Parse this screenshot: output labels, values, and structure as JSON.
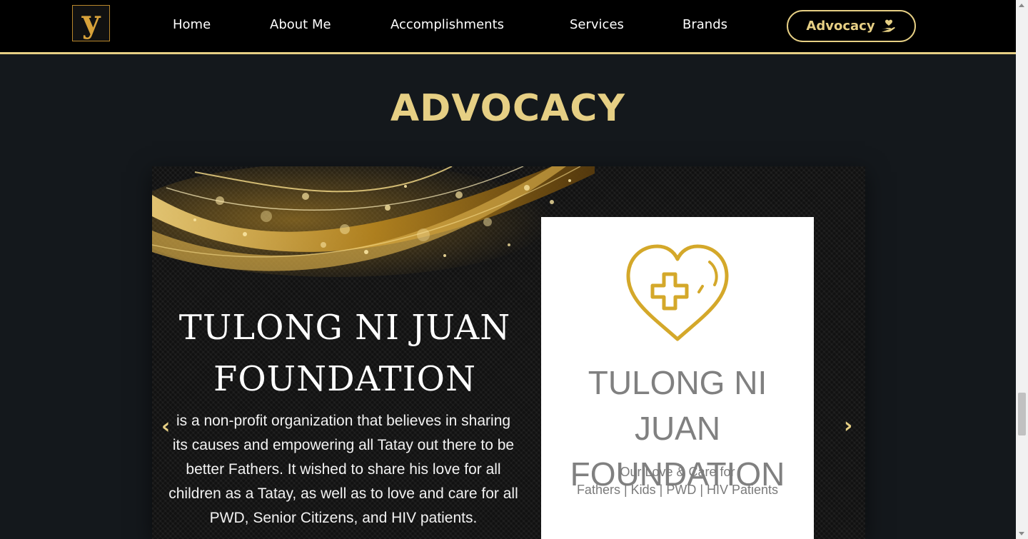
{
  "nav": {
    "logo_letter": "y",
    "links": [
      "Home",
      "About Me",
      "Accomplishments",
      "Services",
      "Brands"
    ],
    "cta": {
      "label": "Advocacy",
      "icon": "hand-holding-heart-icon"
    }
  },
  "section": {
    "title": "ADVOCACY"
  },
  "slide": {
    "title_line1": "TULONG NI JUAN",
    "title_line2": "FOUNDATION",
    "description": "is a non-profit organization that believes in sharing its causes and empowering all Tatay out there to be better Fathers. It wished to share his love for all children as a Tatay, as well as to love and care for all PWD, Senior Citizens, and HIV patients.",
    "prev_arrow": "‹",
    "next_arrow": "›",
    "logo": {
      "name_line1": "TULONG NI JUAN",
      "name_line2": "FOUNDATION",
      "tagline_line1": "Our Love & Care for",
      "tagline_line2": "Fathers | Kids | PWD | HIV Patients",
      "icon": "heart-cross-icon"
    }
  },
  "colors": {
    "accent": "#e6cf84",
    "background": "#14181c",
    "header": "#000000",
    "logo_gold": "#d4a82a"
  }
}
